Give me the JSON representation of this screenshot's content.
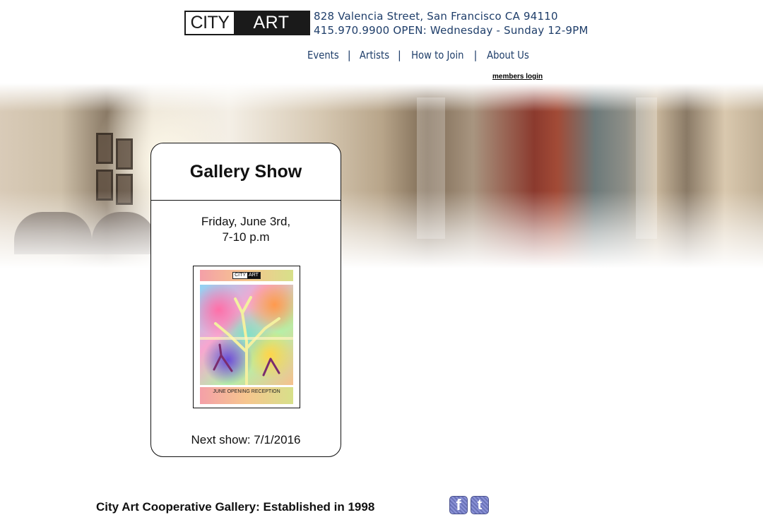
{
  "header": {
    "logo": {
      "city": "CITY",
      "art": "ART"
    },
    "address_line": "828 Valencia Street,  San Francisco CA 94110",
    "hours_line": "415.970.9900   OPEN: Wednesday - Sunday 12-9PM"
  },
  "nav": {
    "items": [
      {
        "label": "Events"
      },
      {
        "label": "Artists"
      },
      {
        "label": "How to Join"
      },
      {
        "label": "About Us"
      }
    ],
    "separator": "|"
  },
  "members_login": "members login",
  "card": {
    "title": "Gallery Show",
    "date_line1": "Friday, June 3rd,",
    "date_line2": "7-10 p.m",
    "poster": {
      "logo_city": "CITY",
      "logo_art": "ART",
      "caption": "JUNE OPENING RECEPTION"
    },
    "next_show": "Next show: 7/1/2016"
  },
  "footer": {
    "tagline": "City Art Cooperative Gallery: Established in 1998",
    "social": [
      {
        "name": "facebook",
        "glyph": "f",
        "icon": "facebook-icon"
      },
      {
        "name": "twitter",
        "glyph": "t",
        "icon": "twitter-icon"
      }
    ]
  },
  "colors": {
    "nav_text": "#1f3e6a",
    "text": "#111111",
    "social_bg": "#7a82c6"
  }
}
